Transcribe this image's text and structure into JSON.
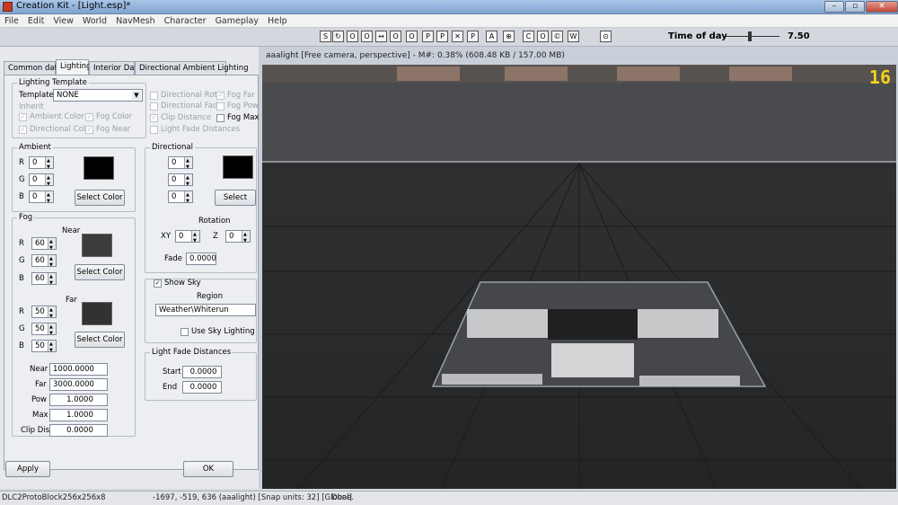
{
  "window": {
    "title": "Creation Kit - [Light.esp]*",
    "min": "–",
    "max": "▫",
    "close": "✕"
  },
  "menu": [
    "File",
    "Edit",
    "View",
    "World",
    "NavMesh",
    "Character",
    "Gameplay",
    "Help"
  ],
  "toolbar": {
    "icons": [
      "S",
      "↻",
      "O",
      "O",
      "↔",
      "O",
      "O",
      "P",
      "P",
      "✕",
      "P",
      "A",
      "⊕",
      "C",
      "O",
      "©",
      "W",
      "⊙"
    ],
    "time_of_day_label": "Time of day",
    "time_of_day_value": "7.50"
  },
  "tabs": [
    "Common data",
    "Lighting",
    "Interior Data",
    "Directional Ambient Lighting"
  ],
  "lighting": {
    "template_group": "Lighting Template",
    "template_label": "Template",
    "template_value": "NONE",
    "inherit_label": "Inherit",
    "inherit": [
      "Ambient Color",
      "Fog Color",
      "Directional Color",
      "Fog Near"
    ],
    "inherit_right": [
      "Directional Rot",
      "Fog Far",
      "Directional Fade",
      "Fog Pow",
      "Clip Distance",
      "Fog Max",
      "Light Fade Distances"
    ]
  },
  "ambient": {
    "title": "Ambient",
    "r": "0",
    "g": "0",
    "b": "0",
    "button": "Select Color",
    "r_label": "R",
    "g_label": "G",
    "b_label": "B",
    "swatch": "#000000"
  },
  "directional": {
    "title": "Directional",
    "r": "0",
    "g": "0",
    "b": "0",
    "button": "Select Color",
    "rotation": "Rotation",
    "xy_label": "XY",
    "xy": "0",
    "z_label": "Z",
    "z": "0",
    "fade_label": "Fade",
    "fade": "0.0000",
    "swatch": "#000000"
  },
  "fog": {
    "title": "Fog",
    "near_label": "Near",
    "near_r": "60",
    "near_g": "60",
    "near_b": "60",
    "near_button": "Select Color",
    "near_swatch": "#3c3c3c",
    "far_label": "Far",
    "far_r": "50",
    "far_g": "50",
    "far_b": "50",
    "far_button": "Select Color",
    "far_swatch": "#323232",
    "near_dist_label": "Near",
    "near_dist": "1000.0000",
    "far_dist_label": "Far",
    "far_dist": "3000.0000",
    "pow_label": "Pow",
    "pow": "1.0000",
    "max_label": "Max",
    "max": "1.0000",
    "clip_label": "Clip Dist",
    "clip": "0.0000"
  },
  "sky": {
    "show_label": "Show Sky",
    "region_label": "Region",
    "region_value": "Weather\\Whiterun",
    "use_sky": "Use Sky Lighting"
  },
  "light_fade": {
    "title": "Light Fade Distances",
    "start_label": "Start",
    "start": "0.0000",
    "end_label": "End",
    "end": "0.0000"
  },
  "buttons": {
    "apply": "Apply",
    "ok": "OK"
  },
  "viewport": {
    "title": "aaalight [Free camera, perspective] - M#: 0.38% (608.48 KB / 157.00 MB)",
    "fps": "16"
  },
  "status": {
    "cell1": "DLC2ProtoBlock256x256x8",
    "cell2": "-1697, -519, 636 (aaalight) [Snap units: 32] [Global]",
    "cell3": "Done."
  }
}
